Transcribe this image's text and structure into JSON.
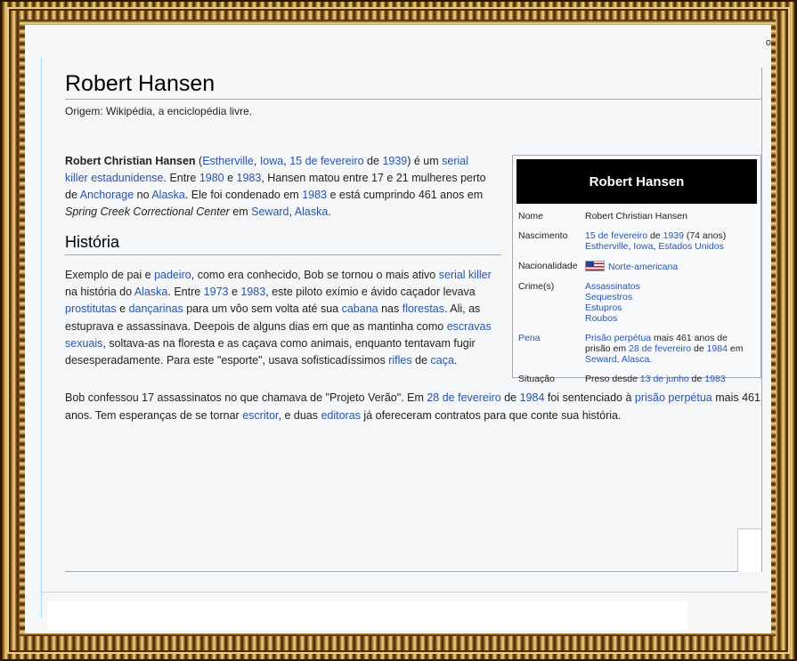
{
  "article": {
    "title": "Robert Hansen",
    "origin": "Origem: Wikipédia, a enciclopédia livre."
  },
  "edge_text": "o",
  "intro": {
    "name_bold": "Robert Christian Hansen",
    "open_paren": " (",
    "link_estherville": "Estherville",
    "comma1": ", ",
    "link_iowa": "Iowa",
    "comma2": ", ",
    "link_15fev": "15 de fevereiro",
    "de1": " de ",
    "link_1939": "1939",
    "close_paren": ") é um ",
    "link_serial_killer": "serial killer",
    "space1": " ",
    "link_estadunidense": "estadunidense",
    "t1": ". Entre ",
    "link_1980": "1980",
    "t2": " e ",
    "link_1983a": "1983",
    "t3": ", Hansen matou entre 17 e 21 mulheres perto de ",
    "link_anchorage": "Anchorage",
    "t4": " no ",
    "link_alaska": "Alaska",
    "t5": ". Ele foi condenado em ",
    "link_1983b": "1983",
    "t6": " e está cumprindo 461 anos em ",
    "italic_prison": "Spring Creek Correctional Center",
    "t7": " em ",
    "link_seward": "Seward",
    "comma3": ", ",
    "link_alaska2": "Alaska",
    "t8": "."
  },
  "section_history": "História",
  "history": {
    "h1": "Exemplo de pai e ",
    "link_padeiro": "padeiro",
    "h2": ", como era conhecido, Bob se tornou o mais ativo ",
    "link_serial_killer": "serial killer",
    "h3": " na história do ",
    "link_alaska": "Alaska",
    "h4": ". Entre ",
    "link_1973": "1973",
    "h5": " e ",
    "link_1983": "1983",
    "h6": ", este piloto exímio e ávido caçador levava ",
    "link_prostitutas": "prostitutas",
    "h7": " e ",
    "link_dancarinas": "dançarinas",
    "h8": " para um vôo sem volta até sua ",
    "link_cabana": "cabana",
    "h9": " nas ",
    "link_florestas": "florestas",
    "h10": ". Ali, as estuprava e assassinava. Deepois de alguns dias em que as mantinha como ",
    "link_escravas": "escravas sexuais",
    "h11": ", soltava-as na floresta e as caçava como animais, enquanto tentavam fugir desesperadamente. Para este \"esporte\", usava sofisticadíssimos ",
    "link_rifles": "rifles",
    "h12": " de ",
    "link_caca": "caça",
    "h13": "."
  },
  "bottom": {
    "b1": "Bob confessou 17 assassinatos no que chamava de \"Projeto Verão\". Em ",
    "link_28fev": "28 de fevereiro",
    "b2": " de ",
    "link_1984": "1984",
    "b3": " foi sentenciado à ",
    "link_prisao": "prisão perpétua",
    "b4": " mais 461 anos. Tem esperanças de se tornar ",
    "link_escritor": "escritor",
    "b5": ", e duas ",
    "link_editoras": "editoras",
    "b6": " já ofereceram contratos para que conte sua história."
  },
  "infobox": {
    "title": "Robert Hansen",
    "nome_label": "Nome",
    "nome_value": "Robert Christian Hansen",
    "nasc_label": "Nascimento",
    "nasc_link_date": "15 de fevereiro",
    "nasc_de": " de ",
    "nasc_link_year": "1939",
    "nasc_age": " (74 anos)",
    "nasc_link_estherville": "Estherville",
    "nasc_comma1": ", ",
    "nasc_link_iowa": "Iowa",
    "nasc_comma2": ", ",
    "nasc_link_eua": "Estados Unidos",
    "nac_label": "Nacionalidade",
    "nac_value": "Norte-americana",
    "crimes_label": "Crime(s)",
    "crimes": [
      "Assassinatos",
      "Sequestros",
      "Estupros",
      "Roubos"
    ],
    "pena_label": "Pena",
    "pena_link": "Prisão perpétua",
    "pena_t1": " mais 461 anos de prisão em ",
    "pena_link_date": "28 de fevereiro",
    "pena_de": " de ",
    "pena_link_year": "1984",
    "pena_em": " em ",
    "pena_link_seward": "Seward, Alasca",
    "pena_dot": ".",
    "sit_label": "Situação",
    "sit_t1": "Preso desde ",
    "sit_link_date": "13 de junho",
    "sit_de": " de ",
    "sit_link_year": "1983"
  },
  "colors": {
    "link": "#2a54a8",
    "frame_gold": "#c9943c",
    "page_bg": "#f4f6f8",
    "infobox_header": "#000000"
  }
}
